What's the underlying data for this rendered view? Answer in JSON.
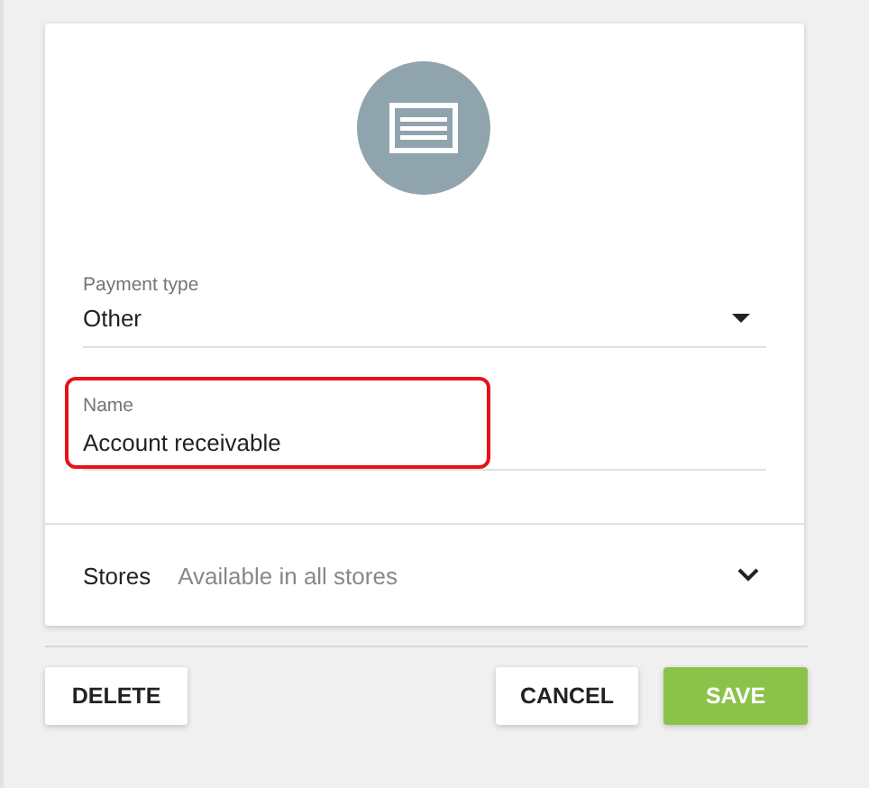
{
  "payment_type": {
    "label": "Payment type",
    "value": "Other"
  },
  "name_field": {
    "label": "Name",
    "value": "Account receivable",
    "highlighted": true
  },
  "stores": {
    "label": "Stores",
    "value": "Available in all stores",
    "expanded": false
  },
  "buttons": [
    {
      "label": "DELETE",
      "kind": "plain"
    },
    {
      "label": "CANCEL",
      "kind": "plain"
    },
    {
      "label": "SAVE",
      "kind": "primary"
    }
  ]
}
